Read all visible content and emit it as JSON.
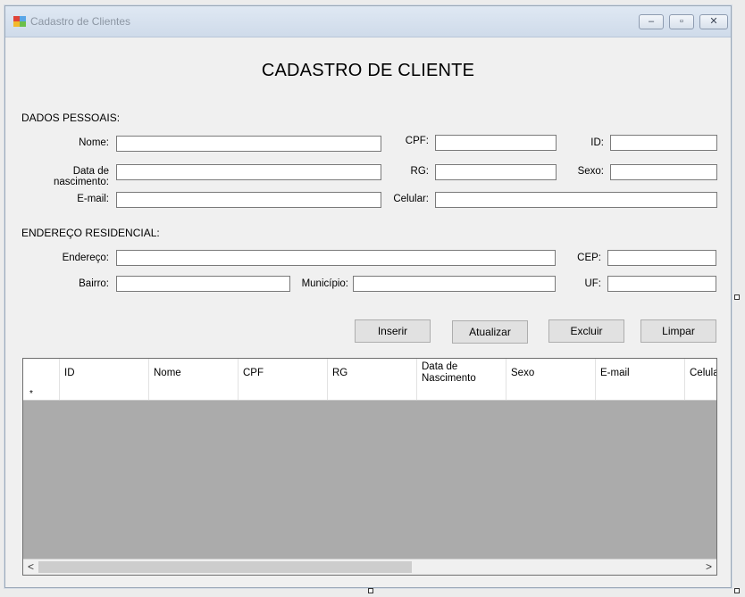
{
  "window": {
    "title": "Cadastro de Clientes"
  },
  "heading": "CADASTRO DE CLIENTE",
  "sections": {
    "personal": "DADOS PESSOAIS:",
    "address": "ENDEREÇO RESIDENCIAL:"
  },
  "labels": {
    "nome": "Nome:",
    "data_nascimento": "Data de nascimento:",
    "email": "E-mail:",
    "cpf": "CPF:",
    "rg": "RG:",
    "celular": "Celular:",
    "id": "ID:",
    "sexo": "Sexo:",
    "endereco": "Endereço:",
    "bairro": "Bairro:",
    "municipio": "Município:",
    "cep": "CEP:",
    "uf": "UF:"
  },
  "buttons": {
    "inserir": "Inserir",
    "atualizar": "Atualizar",
    "excluir": "Excluir",
    "limpar": "Limpar"
  },
  "grid": {
    "columns": [
      "ID",
      "Nome",
      "CPF",
      "RG",
      "Data de Nascimento",
      "Sexo",
      "E-mail",
      "Celula"
    ],
    "new_row_marker": "*"
  },
  "scrollbar": {
    "left_arrow": "<",
    "right_arrow": ">"
  }
}
